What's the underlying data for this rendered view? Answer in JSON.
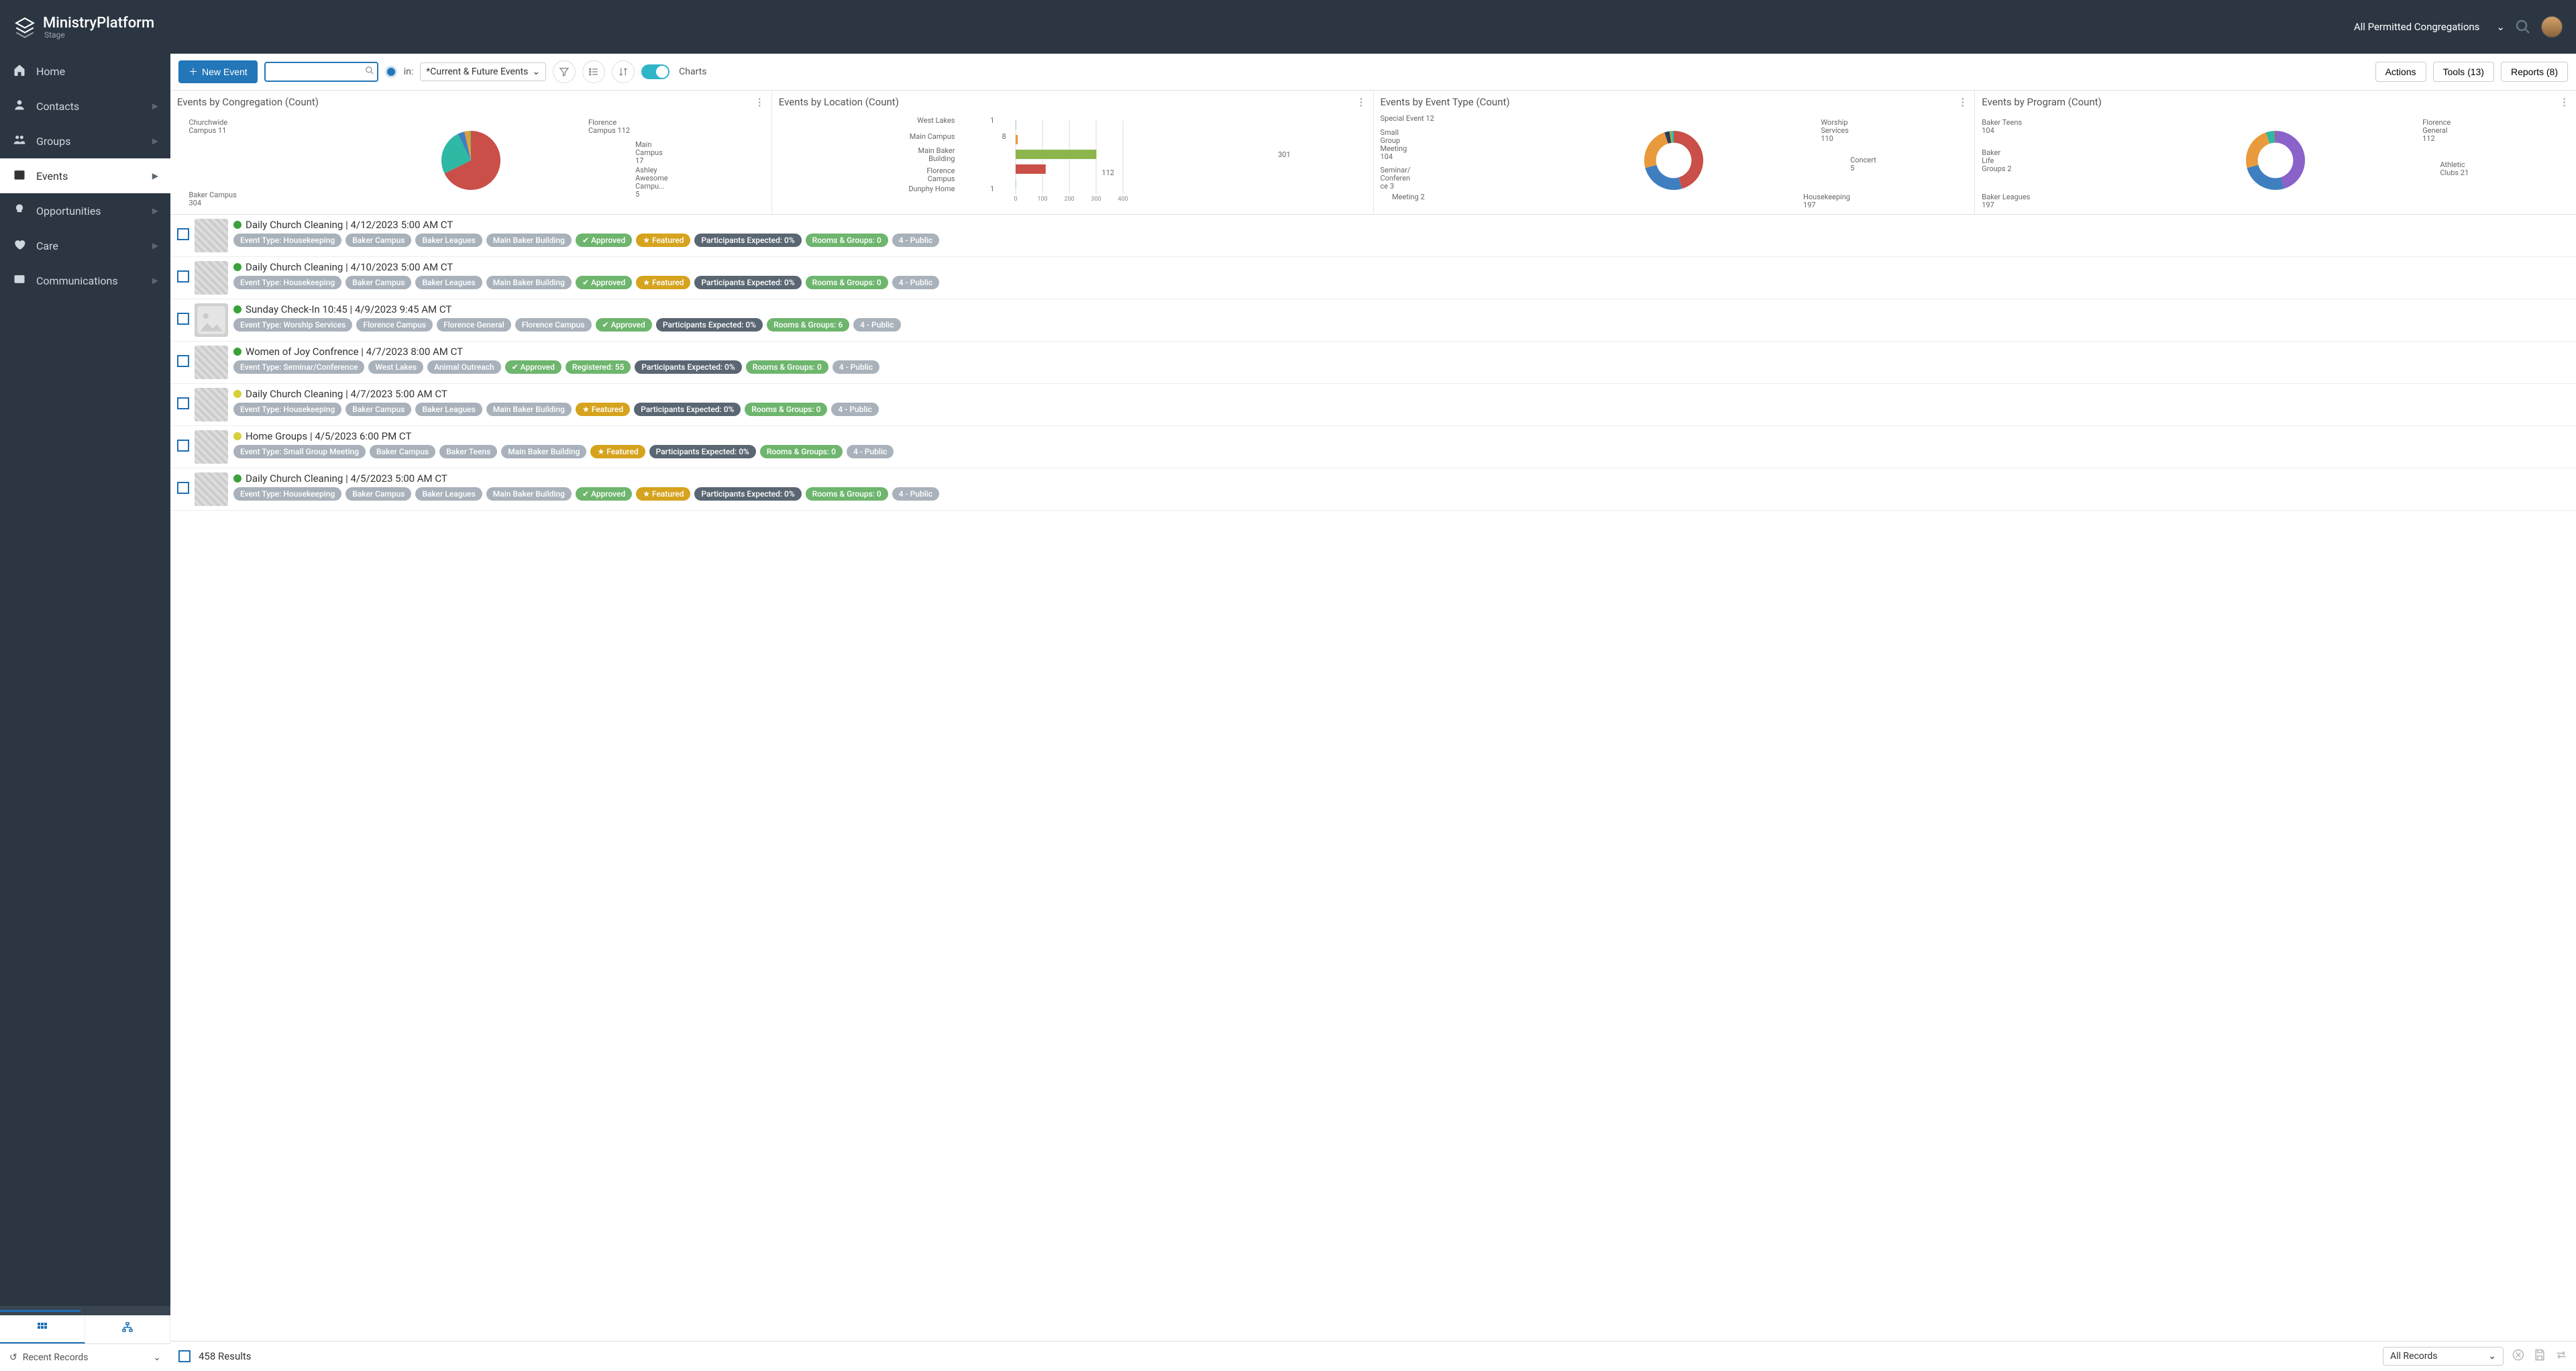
{
  "brand": {
    "title": "MinistryPlatform",
    "subtitle": "Stage"
  },
  "topbar": {
    "congregation_selector": "All Permitted Congregations"
  },
  "sidebar": {
    "items": [
      {
        "label": "Home",
        "icon": "home"
      },
      {
        "label": "Contacts",
        "icon": "user",
        "expandable": true
      },
      {
        "label": "Groups",
        "icon": "users",
        "expandable": true
      },
      {
        "label": "Events",
        "icon": "calendar",
        "expandable": true,
        "active": true
      },
      {
        "label": "Opportunities",
        "icon": "bulb",
        "expandable": true
      },
      {
        "label": "Care",
        "icon": "heart",
        "expandable": true
      },
      {
        "label": "Communications",
        "icon": "mail",
        "expandable": true
      }
    ],
    "recent_label": "Recent Records"
  },
  "toolbar": {
    "new_label": "New Event",
    "search_placeholder": "",
    "in_label": "in:",
    "view_label": "*Current & Future Events",
    "charts_label": "Charts",
    "actions_label": "Actions",
    "tools_label": "Tools (13)",
    "reports_label": "Reports (8)"
  },
  "charts": [
    {
      "title": "Events by Congregation (Count)"
    },
    {
      "title": "Events by Location (Count)"
    },
    {
      "title": "Events by Event Type (Count)"
    },
    {
      "title": "Events by Program (Count)"
    }
  ],
  "chart_data": [
    {
      "type": "pie",
      "title": "Events by Congregation (Count)",
      "series": [
        {
          "name": "Baker Campus",
          "value": 304,
          "color": "#c94f48"
        },
        {
          "name": "Florence Campus",
          "value": 112,
          "color": "#2eb9a4"
        },
        {
          "name": "Main Campus",
          "value": 17,
          "color": "#3f7fbf"
        },
        {
          "name": "Churchwide Campus",
          "value": 11,
          "color": "#e99a3c"
        },
        {
          "name": "Ashley Awesome Campu...",
          "value": 5,
          "color": "#8cb64c"
        }
      ]
    },
    {
      "type": "bar",
      "title": "Events by Location (Count)",
      "orientation": "horizontal",
      "xlim": [
        0,
        400
      ],
      "xticks": [
        0,
        100,
        200,
        300,
        400
      ],
      "categories": [
        "West Lakes",
        "Main Campus",
        "Main Baker Building",
        "Florence Campus",
        "Dunphy Home"
      ],
      "values": [
        1,
        8,
        301,
        112,
        1
      ],
      "colors": [
        "#3f7fbf",
        "#e99a3c",
        "#8cb64c",
        "#c94f48",
        "#2eb9a4"
      ]
    },
    {
      "type": "pie",
      "variant": "donut",
      "title": "Events by Event Type (Count)",
      "series": [
        {
          "name": "Housekeeping",
          "value": 197,
          "color": "#c94f48"
        },
        {
          "name": "Worship Services",
          "value": 110,
          "color": "#3f7fbf"
        },
        {
          "name": "Small Group Meeting",
          "value": 104,
          "color": "#e99a3c"
        },
        {
          "name": "Special Event",
          "value": 12,
          "color": "#2e3a59"
        },
        {
          "name": "Concert",
          "value": 5,
          "color": "#8cb64c"
        },
        {
          "name": "Seminar/Conference",
          "value": 3,
          "color": "#2eb9a4"
        },
        {
          "name": "Meeting",
          "value": 2,
          "color": "#2eb9a4"
        }
      ]
    },
    {
      "type": "pie",
      "variant": "donut",
      "title": "Events by Program (Count)",
      "series": [
        {
          "name": "Baker Leagues",
          "value": 197,
          "color": "#8a62c9"
        },
        {
          "name": "Florence General",
          "value": 112,
          "color": "#3f7fbf"
        },
        {
          "name": "Baker Teens",
          "value": 104,
          "color": "#e99a3c"
        },
        {
          "name": "Athletic Clubs",
          "value": 21,
          "color": "#2eb9a4"
        },
        {
          "name": "Baker Life Groups",
          "value": 2,
          "color": "#c94f48"
        }
      ]
    }
  ],
  "events": [
    {
      "status_color": "#3aa23a",
      "title": "Daily Church Cleaning | 4/12/2023 5:00 AM CT",
      "pills": [
        {
          "text": "Event Type: Housekeeping",
          "cls": "p-gray"
        },
        {
          "text": "Baker Campus",
          "cls": "p-gray"
        },
        {
          "text": "Baker Leagues",
          "cls": "p-gray"
        },
        {
          "text": "Main Baker Building",
          "cls": "p-gray"
        },
        {
          "text": "Approved",
          "cls": "p-green",
          "icon": "check"
        },
        {
          "text": "Featured",
          "cls": "p-yellow",
          "icon": "star"
        },
        {
          "text": "Participants Expected: 0%",
          "cls": "p-dark"
        },
        {
          "text": "Rooms & Groups: 0",
          "cls": "p-green"
        },
        {
          "text": "4 - Public",
          "cls": "p-gray"
        }
      ]
    },
    {
      "status_color": "#3aa23a",
      "title": "Daily Church Cleaning | 4/10/2023 5:00 AM CT",
      "pills": [
        {
          "text": "Event Type: Housekeeping",
          "cls": "p-gray"
        },
        {
          "text": "Baker Campus",
          "cls": "p-gray"
        },
        {
          "text": "Baker Leagues",
          "cls": "p-gray"
        },
        {
          "text": "Main Baker Building",
          "cls": "p-gray"
        },
        {
          "text": "Approved",
          "cls": "p-green",
          "icon": "check"
        },
        {
          "text": "Featured",
          "cls": "p-yellow",
          "icon": "star"
        },
        {
          "text": "Participants Expected: 0%",
          "cls": "p-dark"
        },
        {
          "text": "Rooms & Groups: 0",
          "cls": "p-green"
        },
        {
          "text": "4 - Public",
          "cls": "p-gray"
        }
      ]
    },
    {
      "status_color": "#3aa23a",
      "title": "Sunday Check-In 10:45 | 4/9/2023 9:45 AM CT",
      "thumb": "placeholder",
      "pills": [
        {
          "text": "Event Type: Worship Services",
          "cls": "p-gray"
        },
        {
          "text": "Florence Campus",
          "cls": "p-gray"
        },
        {
          "text": "Florence General",
          "cls": "p-gray"
        },
        {
          "text": "Florence Campus",
          "cls": "p-gray"
        },
        {
          "text": "Approved",
          "cls": "p-green",
          "icon": "check"
        },
        {
          "text": "Participants Expected: 0%",
          "cls": "p-dark"
        },
        {
          "text": "Rooms & Groups: 6",
          "cls": "p-green"
        },
        {
          "text": "4 - Public",
          "cls": "p-gray"
        }
      ]
    },
    {
      "status_color": "#3aa23a",
      "title": "Women of Joy Confrence | 4/7/2023 8:00 AM CT",
      "pills": [
        {
          "text": "Event Type: Seminar/Conference",
          "cls": "p-gray"
        },
        {
          "text": "West Lakes",
          "cls": "p-gray"
        },
        {
          "text": "Animal Outreach",
          "cls": "p-gray"
        },
        {
          "text": "Approved",
          "cls": "p-green",
          "icon": "check"
        },
        {
          "text": "Registered: 55",
          "cls": "p-green"
        },
        {
          "text": "Participants Expected: 0%",
          "cls": "p-dark"
        },
        {
          "text": "Rooms & Groups: 0",
          "cls": "p-green"
        },
        {
          "text": "4 - Public",
          "cls": "p-gray"
        }
      ]
    },
    {
      "status_color": "#d6d03a",
      "title": "Daily Church Cleaning | 4/7/2023 5:00 AM CT",
      "pills": [
        {
          "text": "Event Type: Housekeeping",
          "cls": "p-gray"
        },
        {
          "text": "Baker Campus",
          "cls": "p-gray"
        },
        {
          "text": "Baker Leagues",
          "cls": "p-gray"
        },
        {
          "text": "Main Baker Building",
          "cls": "p-gray"
        },
        {
          "text": "Featured",
          "cls": "p-yellow",
          "icon": "star"
        },
        {
          "text": "Participants Expected: 0%",
          "cls": "p-dark"
        },
        {
          "text": "Rooms & Groups: 0",
          "cls": "p-green"
        },
        {
          "text": "4 - Public",
          "cls": "p-gray"
        }
      ]
    },
    {
      "status_color": "#d6d03a",
      "title": "Home Groups | 4/5/2023 6:00 PM CT",
      "pills": [
        {
          "text": "Event Type: Small Group Meeting",
          "cls": "p-gray"
        },
        {
          "text": "Baker Campus",
          "cls": "p-gray"
        },
        {
          "text": "Baker Teens",
          "cls": "p-gray"
        },
        {
          "text": "Main Baker Building",
          "cls": "p-gray"
        },
        {
          "text": "Featured",
          "cls": "p-yellow",
          "icon": "star"
        },
        {
          "text": "Participants Expected: 0%",
          "cls": "p-dark"
        },
        {
          "text": "Rooms & Groups: 0",
          "cls": "p-green"
        },
        {
          "text": "4 - Public",
          "cls": "p-gray"
        }
      ]
    },
    {
      "status_color": "#3aa23a",
      "title": "Daily Church Cleaning | 4/5/2023 5:00 AM CT",
      "pills": [
        {
          "text": "Event Type: Housekeeping",
          "cls": "p-gray"
        },
        {
          "text": "Baker Campus",
          "cls": "p-gray"
        },
        {
          "text": "Baker Leagues",
          "cls": "p-gray"
        },
        {
          "text": "Main Baker Building",
          "cls": "p-gray"
        },
        {
          "text": "Approved",
          "cls": "p-green",
          "icon": "check"
        },
        {
          "text": "Featured",
          "cls": "p-yellow",
          "icon": "star"
        },
        {
          "text": "Participants Expected: 0%",
          "cls": "p-dark"
        },
        {
          "text": "Rooms & Groups: 0",
          "cls": "p-green"
        },
        {
          "text": "4 - Public",
          "cls": "p-gray"
        }
      ]
    }
  ],
  "footer": {
    "results": "458 Results",
    "records_selector": "All Records"
  }
}
